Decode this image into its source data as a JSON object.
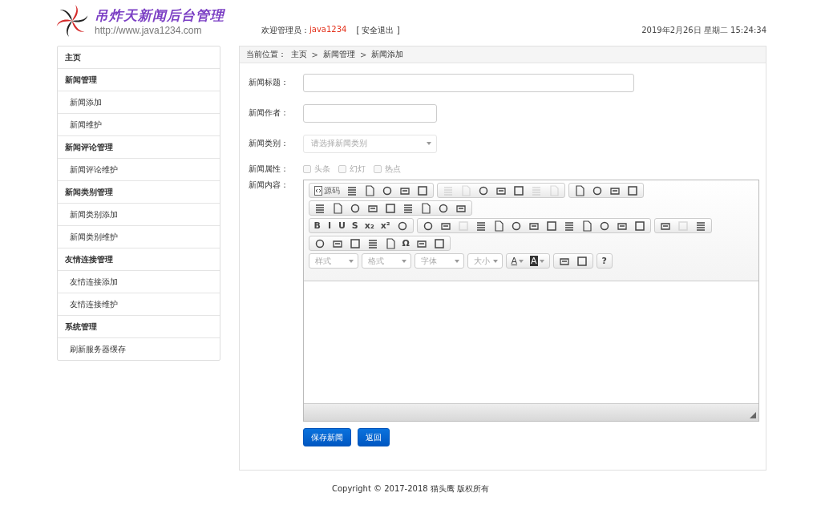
{
  "header": {
    "site_title": "吊炸天新闻后台管理",
    "site_url": "http://www.java1234.com",
    "welcome_label": "欢迎管理员：",
    "username": "java1234",
    "logout": "[ 安全退出 ]",
    "datetime": "2019年2月26日 星期二 15:24:34"
  },
  "sidebar": [
    {
      "text": "主页",
      "kind": "header"
    },
    {
      "text": "新闻管理",
      "kind": "header"
    },
    {
      "text": "新闻添加",
      "kind": "sub"
    },
    {
      "text": "新闻维护",
      "kind": "sub"
    },
    {
      "text": "新闻评论管理",
      "kind": "header"
    },
    {
      "text": "新闻评论维护",
      "kind": "sub"
    },
    {
      "text": "新闻类别管理",
      "kind": "header"
    },
    {
      "text": "新闻类别添加",
      "kind": "sub"
    },
    {
      "text": "新闻类别维护",
      "kind": "sub"
    },
    {
      "text": "友情连接管理",
      "kind": "header"
    },
    {
      "text": "友情连接添加",
      "kind": "sub"
    },
    {
      "text": "友情连接维护",
      "kind": "sub"
    },
    {
      "text": "系统管理",
      "kind": "header"
    },
    {
      "text": "刷新服务器缓存",
      "kind": "sub"
    }
  ],
  "breadcrumb": {
    "label": "当前位置：",
    "path": [
      "主页",
      "新闻管理",
      "新闻添加"
    ],
    "separator": ">"
  },
  "form": {
    "title_label": "新闻标题：",
    "author_label": "新闻作者：",
    "type_label": "新闻类别：",
    "type_placeholder": "请选择新闻类别",
    "attr_label": "新闻属性：",
    "attributes": [
      {
        "text": "头条",
        "checked": false
      },
      {
        "text": "幻灯",
        "checked": false
      },
      {
        "text": "热点",
        "checked": false
      }
    ],
    "content_label": "新闻内容："
  },
  "toolbar_rows": [
    [
      [
        {
          "kind": "source",
          "text": "源码",
          "disabled": false
        },
        {
          "kind": "icon",
          "disabled": false
        },
        {
          "kind": "icon",
          "disabled": false
        },
        {
          "kind": "icon",
          "disabled": false
        },
        {
          "kind": "icon",
          "disabled": false
        },
        {
          "kind": "icon",
          "disabled": false
        }
      ],
      [
        {
          "kind": "icon",
          "disabled": true
        },
        {
          "kind": "icon",
          "disabled": true
        },
        {
          "kind": "icon",
          "disabled": false
        },
        {
          "kind": "icon",
          "disabled": false
        },
        {
          "kind": "icon",
          "disabled": false
        },
        {
          "kind": "icon",
          "disabled": true
        },
        {
          "kind": "icon",
          "disabled": true
        }
      ],
      [
        {
          "kind": "icon",
          "disabled": false
        },
        {
          "kind": "icon",
          "disabled": false
        },
        {
          "kind": "icon",
          "disabled": false
        },
        {
          "kind": "icon",
          "disabled": false
        }
      ]
    ],
    [
      [
        {
          "kind": "icon",
          "disabled": false
        },
        {
          "kind": "icon",
          "disabled": false
        },
        {
          "kind": "icon",
          "disabled": false
        },
        {
          "kind": "icon",
          "disabled": false
        },
        {
          "kind": "icon",
          "disabled": false
        },
        {
          "kind": "icon",
          "disabled": false
        },
        {
          "kind": "icon",
          "disabled": false
        },
        {
          "kind": "icon",
          "disabled": false
        },
        {
          "kind": "icon",
          "disabled": false
        }
      ]
    ],
    [
      [
        {
          "kind": "glyph",
          "text": "B",
          "disabled": false
        },
        {
          "kind": "glyph",
          "text": "I",
          "disabled": false
        },
        {
          "kind": "glyph",
          "text": "U",
          "disabled": false
        },
        {
          "kind": "glyph",
          "text": "S",
          "disabled": false
        },
        {
          "kind": "glyph",
          "text": "x₂",
          "disabled": false
        },
        {
          "kind": "glyph",
          "text": "x²",
          "disabled": false
        },
        {
          "kind": "icon",
          "disabled": false
        }
      ],
      [
        {
          "kind": "icon",
          "disabled": false
        },
        {
          "kind": "icon",
          "disabled": false
        },
        {
          "kind": "icon",
          "disabled": true
        },
        {
          "kind": "icon",
          "disabled": false
        },
        {
          "kind": "icon",
          "disabled": false
        },
        {
          "kind": "icon",
          "disabled": false
        },
        {
          "kind": "icon",
          "disabled": false
        },
        {
          "kind": "icon",
          "disabled": false
        },
        {
          "kind": "icon",
          "disabled": false
        },
        {
          "kind": "icon",
          "disabled": false
        },
        {
          "kind": "icon",
          "disabled": false
        },
        {
          "kind": "icon",
          "disabled": false
        },
        {
          "kind": "icon",
          "disabled": false
        }
      ],
      [
        {
          "kind": "icon",
          "disabled": false
        },
        {
          "kind": "icon",
          "disabled": true
        },
        {
          "kind": "icon",
          "disabled": false
        }
      ]
    ],
    [
      [
        {
          "kind": "icon",
          "disabled": false
        },
        {
          "kind": "icon",
          "disabled": false
        },
        {
          "kind": "icon",
          "disabled": false
        },
        {
          "kind": "icon",
          "disabled": false
        },
        {
          "kind": "icon",
          "disabled": false
        },
        {
          "kind": "glyph",
          "text": "Ω",
          "disabled": false
        },
        {
          "kind": "icon",
          "disabled": false
        },
        {
          "kind": "icon",
          "disabled": false
        }
      ]
    ],
    [
      [
        {
          "kind": "combo",
          "text": "样式",
          "disabled": false
        }
      ],
      [
        {
          "kind": "combo",
          "text": "格式",
          "disabled": false
        }
      ],
      [
        {
          "kind": "combo",
          "text": "字体",
          "disabled": false
        }
      ],
      [
        {
          "kind": "combo",
          "text": "大小",
          "disabled": false
        }
      ],
      [
        {
          "kind": "color",
          "text": "A",
          "disabled": false
        },
        {
          "kind": "color",
          "text": "A",
          "disabled": false
        }
      ],
      [
        {
          "kind": "icon",
          "disabled": false
        },
        {
          "kind": "icon",
          "disabled": false
        }
      ],
      [
        {
          "kind": "glyph",
          "text": "?",
          "disabled": false
        }
      ]
    ]
  ],
  "buttons": [
    "保存新闻",
    "返回"
  ],
  "footer": "Copyright © 2017-2018 猫头鹰 版权所有"
}
